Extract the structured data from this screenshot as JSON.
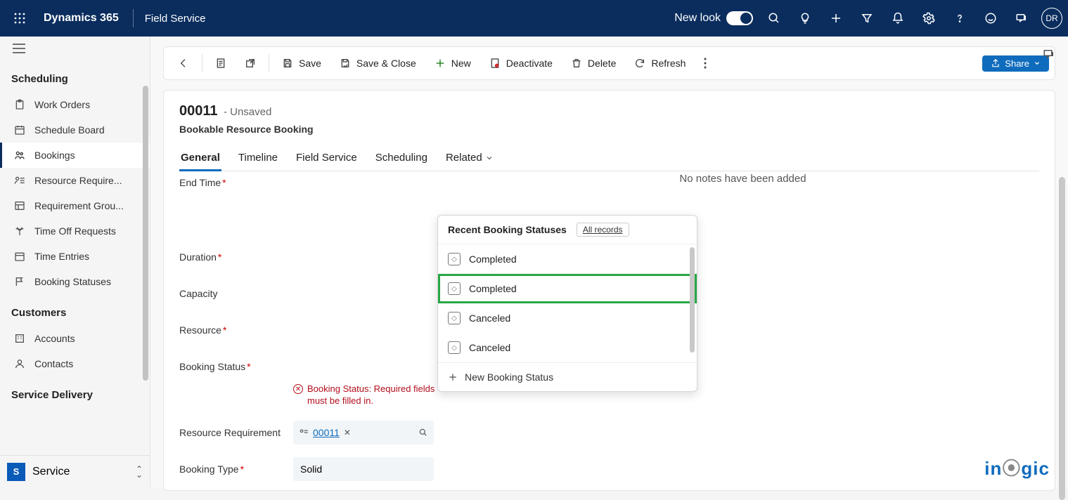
{
  "topbar": {
    "brand": "Dynamics 365",
    "app": "Field Service",
    "newlook_label": "New look",
    "avatar_initials": "DR"
  },
  "sidebar": {
    "section1_title": "Scheduling",
    "items1": [
      {
        "label": "Work Orders"
      },
      {
        "label": "Schedule Board"
      },
      {
        "label": "Bookings"
      },
      {
        "label": "Resource Require..."
      },
      {
        "label": "Requirement Grou..."
      },
      {
        "label": "Time Off Requests"
      },
      {
        "label": "Time Entries"
      },
      {
        "label": "Booking Statuses"
      }
    ],
    "section2_title": "Customers",
    "items2": [
      {
        "label": "Accounts"
      },
      {
        "label": "Contacts"
      }
    ],
    "section3_title": "Service Delivery",
    "area_letter": "S",
    "area_label": "Service"
  },
  "commandbar": {
    "save": "Save",
    "saveclose": "Save & Close",
    "new": "New",
    "deactivate": "Deactivate",
    "delete": "Delete",
    "refresh": "Refresh",
    "share": "Share"
  },
  "record": {
    "title": "00011",
    "status": "- Unsaved",
    "entity": "Bookable Resource Booking",
    "tabs": [
      "General",
      "Timeline",
      "Field Service",
      "Scheduling",
      "Related"
    ],
    "fields": {
      "end_time": "End Time",
      "duration": "Duration",
      "capacity": "Capacity",
      "resource": "Resource",
      "booking_status": "Booking Status",
      "resource_requirement": "Resource Requirement",
      "booking_type": "Booking Type"
    },
    "error_text": "Booking Status: Required fields must be filled in.",
    "rr_value": "00011",
    "bt_value": "Solid",
    "notes_empty": "No notes have been added"
  },
  "flyout": {
    "header": "Recent Booking Statuses",
    "all_records": "All records",
    "options": [
      "Completed",
      "Completed",
      "Canceled",
      "Canceled"
    ],
    "new_label": "New Booking Status"
  },
  "watermark_text": "inogic"
}
